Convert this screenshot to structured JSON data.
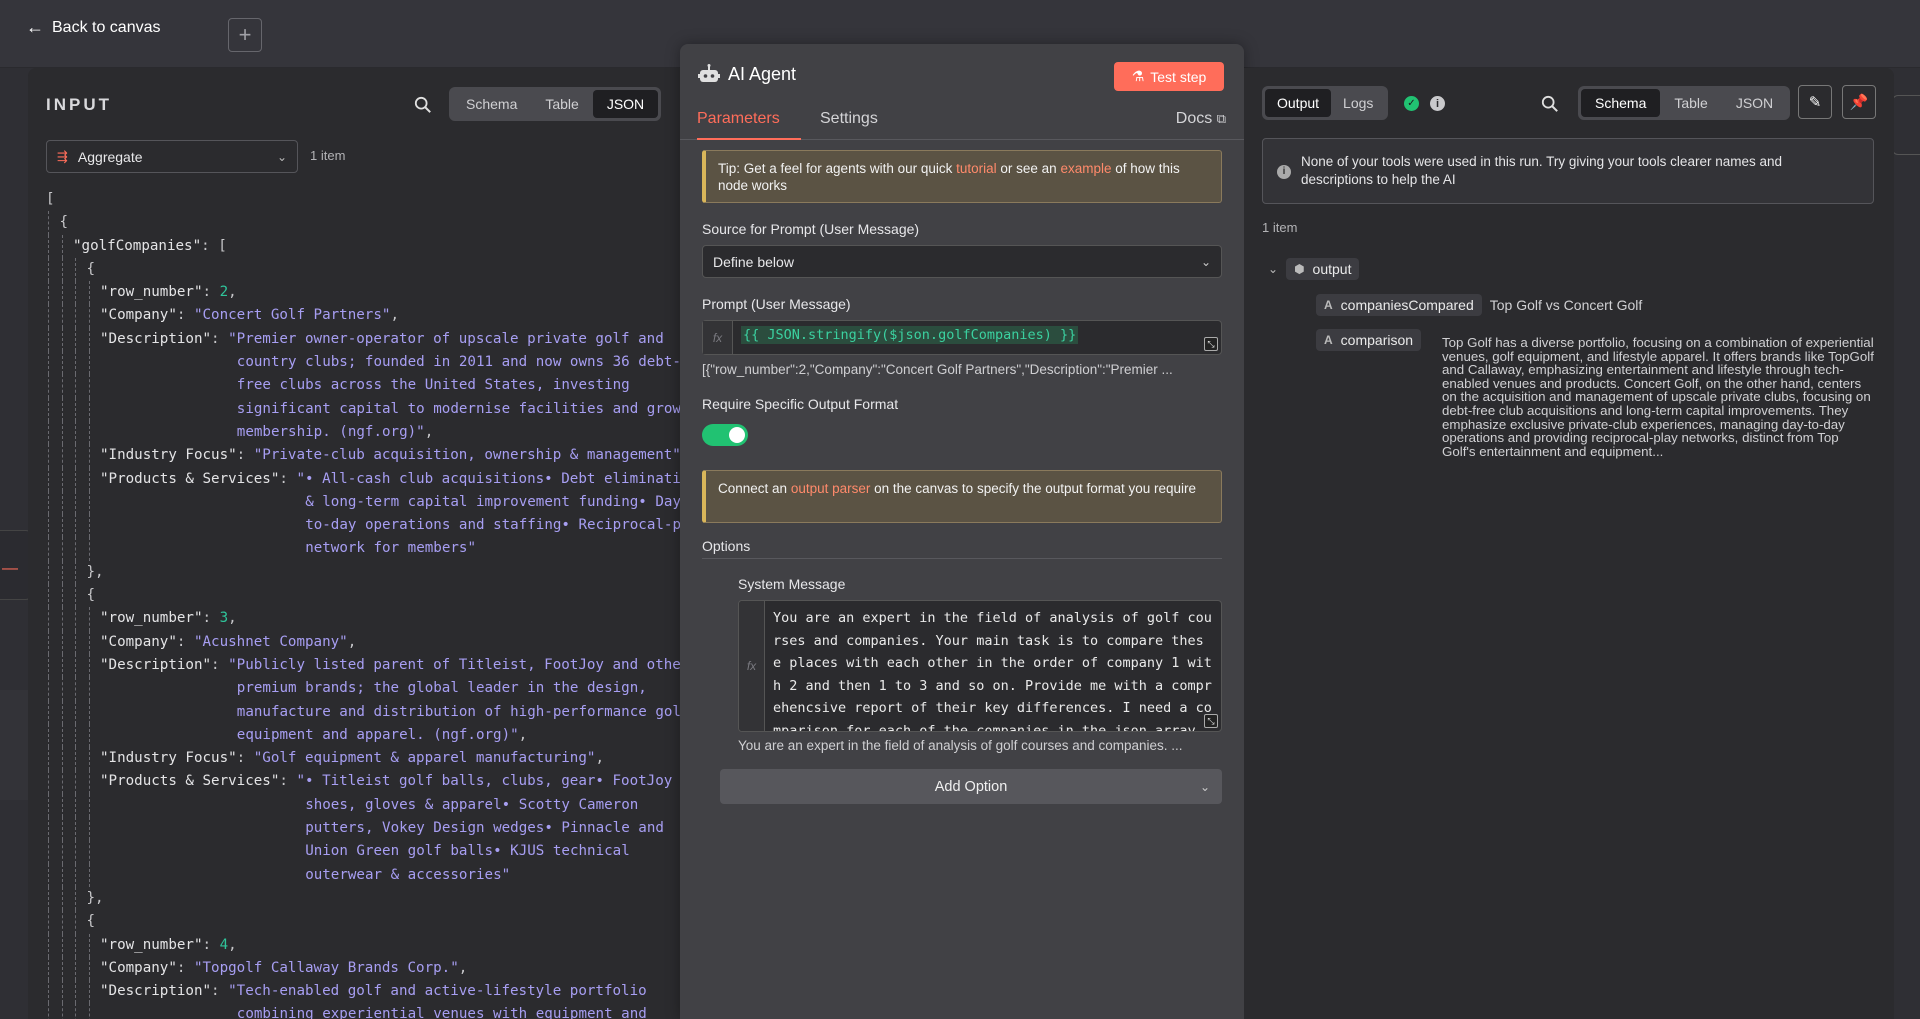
{
  "app": {
    "back_label": "Back to canvas",
    "add_tab_label": "+"
  },
  "input_panel": {
    "title": "INPUT",
    "view_tabs": [
      "Schema",
      "Table",
      "JSON"
    ],
    "active_view": "JSON",
    "node_select": "Aggregate",
    "item_count": "1 item",
    "json_lines": [
      {
        "indent": 0,
        "parts": [
          {
            "t": "p",
            "v": "["
          }
        ]
      },
      {
        "indent": 1,
        "parts": [
          {
            "t": "p",
            "v": "{"
          }
        ]
      },
      {
        "indent": 2,
        "parts": [
          {
            "t": "k",
            "v": "\"golfCompanies\""
          },
          {
            "t": "p",
            "v": ": ["
          }
        ]
      },
      {
        "indent": 3,
        "parts": [
          {
            "t": "p",
            "v": "{"
          }
        ]
      },
      {
        "indent": 4,
        "parts": [
          {
            "t": "k",
            "v": "\"row_number\""
          },
          {
            "t": "p",
            "v": ": "
          },
          {
            "t": "n",
            "v": "2"
          },
          {
            "t": "p",
            "v": ","
          }
        ]
      },
      {
        "indent": 4,
        "parts": [
          {
            "t": "k",
            "v": "\"Company\""
          },
          {
            "t": "p",
            "v": ": "
          },
          {
            "t": "s",
            "v": "\"Concert Golf Partners\""
          },
          {
            "t": "p",
            "v": ","
          }
        ]
      },
      {
        "indent": 4,
        "parts": [
          {
            "t": "k",
            "v": "\"Description\""
          },
          {
            "t": "p",
            "v": ": "
          },
          {
            "t": "s",
            "v": "\"Premier owner-operator of upscale private golf and"
          }
        ]
      },
      {
        "indent": 4,
        "hang": 16,
        "parts": [
          {
            "t": "s",
            "v": "country clubs; founded in 2011 and now owns 36 debt-"
          }
        ]
      },
      {
        "indent": 4,
        "hang": 16,
        "parts": [
          {
            "t": "s",
            "v": "free clubs across the United States, investing"
          }
        ]
      },
      {
        "indent": 4,
        "hang": 16,
        "parts": [
          {
            "t": "s",
            "v": "significant capital to modernise facilities and grow"
          }
        ]
      },
      {
        "indent": 4,
        "hang": 16,
        "parts": [
          {
            "t": "s",
            "v": "membership. (ngf.org)\""
          },
          {
            "t": "p",
            "v": ","
          }
        ]
      },
      {
        "indent": 4,
        "parts": [
          {
            "t": "k",
            "v": "\"Industry Focus\""
          },
          {
            "t": "p",
            "v": ": "
          },
          {
            "t": "s",
            "v": "\"Private-club acquisition, ownership & management\""
          },
          {
            "t": "p",
            "v": ","
          }
        ]
      },
      {
        "indent": 4,
        "parts": [
          {
            "t": "k",
            "v": "\"Products & Services\""
          },
          {
            "t": "p",
            "v": ": "
          },
          {
            "t": "s",
            "v": "\"• All-cash club acquisitions• Debt elimination"
          }
        ]
      },
      {
        "indent": 4,
        "hang": 24,
        "parts": [
          {
            "t": "s",
            "v": "& long-term capital improvement funding• Day-"
          }
        ]
      },
      {
        "indent": 4,
        "hang": 24,
        "parts": [
          {
            "t": "s",
            "v": "to-day operations and staffing• Reciprocal-play"
          }
        ]
      },
      {
        "indent": 4,
        "hang": 24,
        "parts": [
          {
            "t": "s",
            "v": "network for members\""
          }
        ]
      },
      {
        "indent": 3,
        "parts": [
          {
            "t": "p",
            "v": "},"
          }
        ]
      },
      {
        "indent": 3,
        "parts": [
          {
            "t": "p",
            "v": "{"
          }
        ]
      },
      {
        "indent": 4,
        "parts": [
          {
            "t": "k",
            "v": "\"row_number\""
          },
          {
            "t": "p",
            "v": ": "
          },
          {
            "t": "n",
            "v": "3"
          },
          {
            "t": "p",
            "v": ","
          }
        ]
      },
      {
        "indent": 4,
        "parts": [
          {
            "t": "k",
            "v": "\"Company\""
          },
          {
            "t": "p",
            "v": ": "
          },
          {
            "t": "s",
            "v": "\"Acushnet Company\""
          },
          {
            "t": "p",
            "v": ","
          }
        ]
      },
      {
        "indent": 4,
        "parts": [
          {
            "t": "k",
            "v": "\"Description\""
          },
          {
            "t": "p",
            "v": ": "
          },
          {
            "t": "s",
            "v": "\"Publicly listed parent of Titleist, FootJoy and other"
          }
        ]
      },
      {
        "indent": 4,
        "hang": 16,
        "parts": [
          {
            "t": "s",
            "v": "premium brands; the global leader in the design,"
          }
        ]
      },
      {
        "indent": 4,
        "hang": 16,
        "parts": [
          {
            "t": "s",
            "v": "manufacture and distribution of high-performance golf"
          }
        ]
      },
      {
        "indent": 4,
        "hang": 16,
        "parts": [
          {
            "t": "s",
            "v": "equipment and apparel. (ngf.org)\""
          },
          {
            "t": "p",
            "v": ","
          }
        ]
      },
      {
        "indent": 4,
        "parts": [
          {
            "t": "k",
            "v": "\"Industry Focus\""
          },
          {
            "t": "p",
            "v": ": "
          },
          {
            "t": "s",
            "v": "\"Golf equipment & apparel manufacturing\""
          },
          {
            "t": "p",
            "v": ","
          }
        ]
      },
      {
        "indent": 4,
        "parts": [
          {
            "t": "k",
            "v": "\"Products & Services\""
          },
          {
            "t": "p",
            "v": ": "
          },
          {
            "t": "s",
            "v": "\"• Titleist golf balls, clubs, gear• FootJoy"
          }
        ]
      },
      {
        "indent": 4,
        "hang": 24,
        "parts": [
          {
            "t": "s",
            "v": "shoes, gloves & apparel• Scotty Cameron"
          }
        ]
      },
      {
        "indent": 4,
        "hang": 24,
        "parts": [
          {
            "t": "s",
            "v": "putters, Vokey Design wedges• Pinnacle and"
          }
        ]
      },
      {
        "indent": 4,
        "hang": 24,
        "parts": [
          {
            "t": "s",
            "v": "Union Green golf balls• KJUS technical"
          }
        ]
      },
      {
        "indent": 4,
        "hang": 24,
        "parts": [
          {
            "t": "s",
            "v": "outerwear & accessories\""
          }
        ]
      },
      {
        "indent": 3,
        "parts": [
          {
            "t": "p",
            "v": "},"
          }
        ]
      },
      {
        "indent": 3,
        "parts": [
          {
            "t": "p",
            "v": "{"
          }
        ]
      },
      {
        "indent": 4,
        "parts": [
          {
            "t": "k",
            "v": "\"row_number\""
          },
          {
            "t": "p",
            "v": ": "
          },
          {
            "t": "n",
            "v": "4"
          },
          {
            "t": "p",
            "v": ","
          }
        ]
      },
      {
        "indent": 4,
        "parts": [
          {
            "t": "k",
            "v": "\"Company\""
          },
          {
            "t": "p",
            "v": ": "
          },
          {
            "t": "s",
            "v": "\"Topgolf Callaway Brands Corp.\""
          },
          {
            "t": "p",
            "v": ","
          }
        ]
      },
      {
        "indent": 4,
        "parts": [
          {
            "t": "k",
            "v": "\"Description\""
          },
          {
            "t": "p",
            "v": ": "
          },
          {
            "t": "s",
            "v": "\"Tech-enabled golf and active-lifestyle portfolio"
          }
        ]
      },
      {
        "indent": 4,
        "hang": 16,
        "parts": [
          {
            "t": "s",
            "v": "combining experiential venues with equipment and"
          }
        ]
      }
    ]
  },
  "center_panel": {
    "title": "AI Agent",
    "test_button": "Test step",
    "tabs": [
      "Parameters",
      "Settings"
    ],
    "active_tab": "Parameters",
    "docs_label": "Docs",
    "tip": {
      "prefix": "Tip: Get a feel for agents with our quick ",
      "link1": "tutorial",
      "middle": " or see an ",
      "link2": "example",
      "suffix": " of how this node works"
    },
    "source_label": "Source for Prompt (User Message)",
    "source_value": "Define below",
    "prompt_label": "Prompt (User Message)",
    "prompt_expr": "{{ JSON.stringify($json.golfCompanies) }}",
    "prompt_preview": "[{\"row_number\":2,\"Company\":\"Concert Golf Partners\",\"Description\":\"Premier ...",
    "require_label": "Require Specific Output Format",
    "require_enabled": true,
    "parser_notice": {
      "prefix": "Connect an ",
      "link": "output parser",
      "suffix": " on the canvas to specify the output format you require"
    },
    "options_label": "Options",
    "system_message_label": "System Message",
    "system_message_lines": [
      "You are an expert in the field of analysis of golf cou",
      "rses and companies. Your main task is to compare thes",
      "e places with each other in the order of company 1 wit",
      "h 2 and then 1 to 3 and so on. Provide me with a compr",
      "ehencsive report of their key differences. I need a co",
      "mparison for each of the companies in the json array"
    ],
    "system_message_preview": "You are an expert in the field of analysis of golf courses and companies. ...",
    "add_option": "Add Option"
  },
  "output_panel": {
    "tabs": [
      "Output",
      "Logs"
    ],
    "active_tab": "Output",
    "view_tabs": [
      "Schema",
      "Table",
      "JSON"
    ],
    "active_view": "Schema",
    "info_banner": "None of your tools were used in this run. Try giving your tools clearer names and descriptions to help the AI",
    "item_count": "1 item",
    "root_key": "output",
    "fields": [
      {
        "key": "companiesCompared",
        "type": "A",
        "value": "Top Golf vs Concert Golf"
      },
      {
        "key": "comparison",
        "type": "A",
        "value": "Top Golf has a diverse portfolio, focusing on a combination of experiential venues, golf equipment, and lifestyle apparel. It offers brands like TopGolf and Callaway, emphasizing entertainment and lifestyle through tech-enabled venues and products. Concert Golf, on the other hand, centers on the acquisition and management of upscale private clubs, focusing on debt-free club acquisitions and long-term capital improvements. They emphasize exclusive private-club experiences, managing day-to-day operations and providing reciprocal-play networks, distinct from Top Golf's entertainment and equipment..."
      }
    ]
  },
  "colors": {
    "accent": "#ff6d5a",
    "success": "#21c272",
    "json_string": "#a79ef2",
    "json_number": "#2fc49a",
    "expression": "#3bd1a0"
  }
}
